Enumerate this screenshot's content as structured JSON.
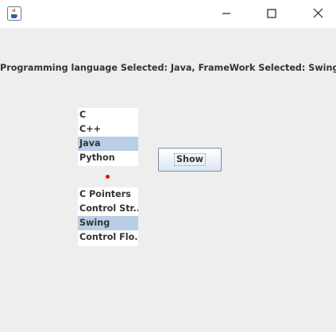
{
  "window": {
    "app_icon": "java-cup-icon",
    "controls": [
      "minimize-icon",
      "maximize-icon",
      "close-icon"
    ]
  },
  "status_text": "Programming language Selected: Java, FrameWork Selected: Swing",
  "language_list": {
    "items": [
      "C",
      "C++",
      "Java",
      "Python"
    ],
    "selected": "Java"
  },
  "framework_list": {
    "items": [
      "C Pointers",
      "Control Str...",
      "Swing",
      "Control Flo..."
    ],
    "selected": "Swing"
  },
  "show_button": {
    "label": "Show"
  },
  "colors": {
    "selection": "#b8cfe5",
    "background": "#eeeeee",
    "indicator_dot": "#dd1111"
  }
}
